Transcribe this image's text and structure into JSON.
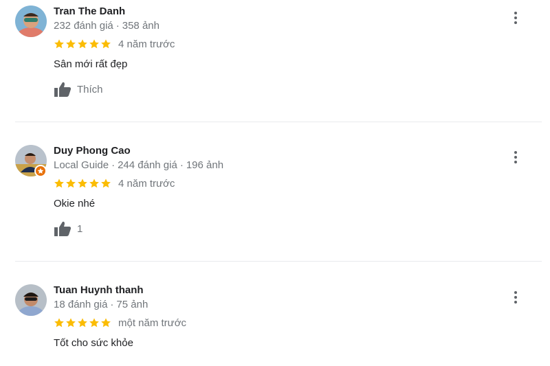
{
  "colors": {
    "star": "#fbbc04",
    "secondary_text": "#70757a",
    "primary_text": "#202124",
    "icon": "#5f6368",
    "local_guide_badge": "#e8710a"
  },
  "reviews": [
    {
      "author": "Tran The Danh",
      "review_count": "232 đánh giá",
      "photo_count": "358 ảnh",
      "rating": 5,
      "time": "4 năm trước",
      "text": "Sân mới rất đẹp",
      "like_label": "Thích",
      "avatar_icon": "user-avatar",
      "more_icon": "more-vert-icon",
      "like_icon": "thumb-up-icon"
    },
    {
      "author": "Duy Phong Cao",
      "badge": "Local Guide",
      "review_count": "244 đánh giá",
      "photo_count": "196 ảnh",
      "rating": 5,
      "time": "4 năm trước",
      "text": "Okie nhé",
      "like_label": "1",
      "avatar_icon": "user-avatar",
      "badge_icon": "local-guide-star-icon",
      "more_icon": "more-vert-icon",
      "like_icon": "thumb-up-icon"
    },
    {
      "author": "Tuan Huynh thanh",
      "review_count": "18 đánh giá",
      "photo_count": "75 ảnh",
      "rating": 5,
      "time": "một năm trước",
      "text": "Tốt cho sức khỏe",
      "avatar_icon": "user-avatar",
      "more_icon": "more-vert-icon"
    }
  ]
}
